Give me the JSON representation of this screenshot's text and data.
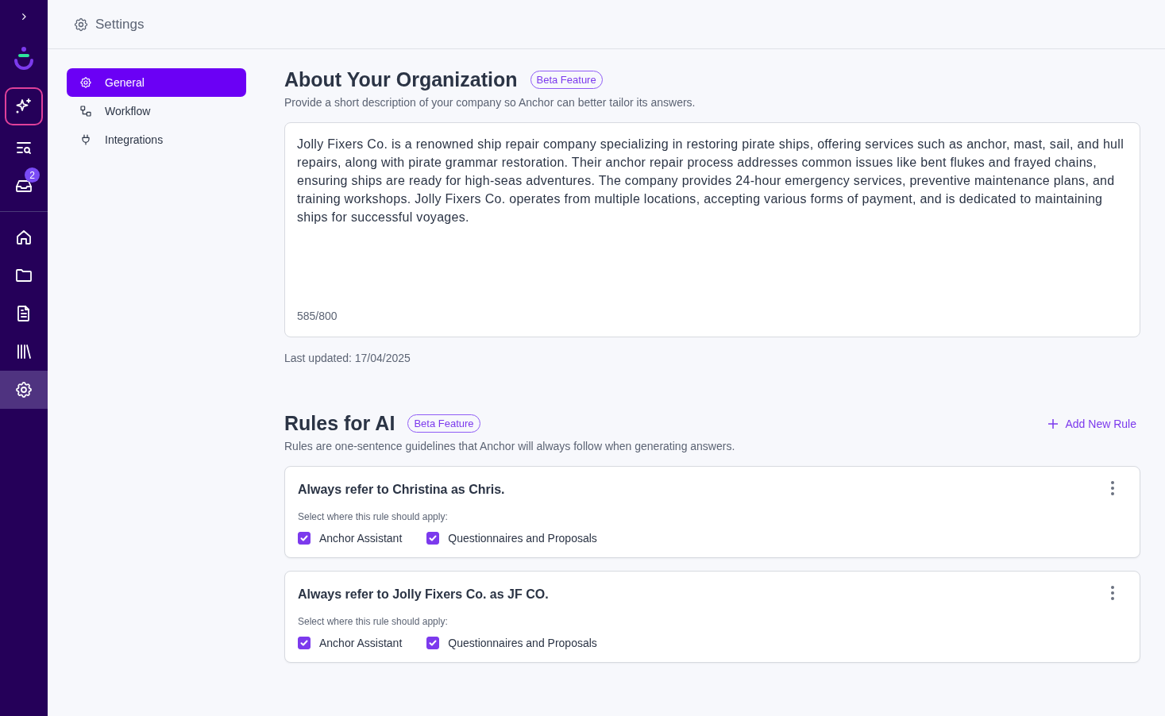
{
  "rail": {
    "items": [
      {
        "kind": "expand",
        "selected": false
      },
      {
        "kind": "logo"
      },
      {
        "kind": "assistant",
        "selected": false
      },
      {
        "kind": "search-list",
        "selected": false
      },
      {
        "kind": "inbox",
        "selected": false,
        "badge": "2"
      },
      {
        "kind": "divider"
      },
      {
        "kind": "home",
        "selected": false
      },
      {
        "kind": "folder",
        "selected": false
      },
      {
        "kind": "document",
        "selected": false
      },
      {
        "kind": "library",
        "selected": false
      },
      {
        "kind": "settings",
        "selected": true
      }
    ]
  },
  "header": {
    "title": "Settings"
  },
  "nav": {
    "items": [
      {
        "label": "General",
        "selected": true
      },
      {
        "label": "Workflow",
        "selected": false
      },
      {
        "label": "Integrations",
        "selected": false
      }
    ]
  },
  "about": {
    "title": "About Your Organization",
    "badge": "Beta Feature",
    "description": "Provide a short description of your company so Anchor can better tailor its answers.",
    "value": "Jolly Fixers Co. is a renowned ship repair company specializing in restoring pirate ships, offering services such as anchor, mast, sail, and hull repairs, along with pirate grammar restoration. Their anchor repair process addresses common issues like bent flukes and frayed chains, ensuring ships are ready for high-seas adventures. The company provides 24-hour emergency services, preventive maintenance plans, and training workshops. Jolly Fixers Co. operates from multiple locations, accepting various forms of payment, and is dedicated to maintaining ships for successful voyages.",
    "counter": "585/800",
    "last_updated": "Last updated: 17/04/2025"
  },
  "rules": {
    "title": "Rules for AI",
    "badge": "Beta Feature",
    "add_button": "Add New Rule",
    "description": "Rules are one-sentence guidelines that Anchor will always follow when generating answers.",
    "items": [
      {
        "text": "Always refer to Christina as Chris.",
        "apply_label": "Select where this rule should apply:",
        "options": [
          {
            "label": "Anchor Assistant",
            "checked": true
          },
          {
            "label": "Questionnaires and Proposals",
            "checked": true
          }
        ]
      },
      {
        "text": "Always refer to Jolly Fixers Co. as JF CO.",
        "apply_label": "Select where this rule should apply:",
        "options": [
          {
            "label": "Anchor Assistant",
            "checked": true
          },
          {
            "label": "Questionnaires and Proposals",
            "checked": true
          }
        ]
      }
    ]
  }
}
